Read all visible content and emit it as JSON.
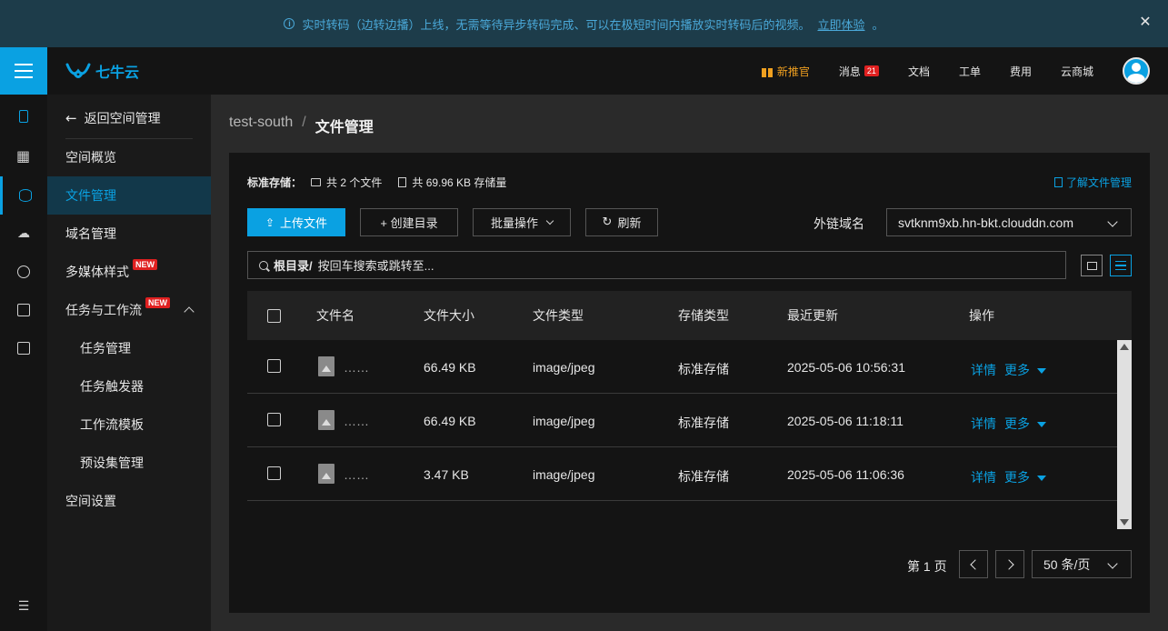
{
  "banner": {
    "text": "实时转码（边转边播）上线，无需等待异步转码完成、可以在极短时间内播放实时转码后的视频。",
    "link": "立即体验",
    "suffix": "。"
  },
  "topbar": {
    "logo": "七牛云",
    "nav": [
      {
        "label": "新推官"
      },
      {
        "label": "消息",
        "badge": "21"
      },
      {
        "label": "文档"
      },
      {
        "label": "工单"
      },
      {
        "label": "费用"
      },
      {
        "label": "云商城"
      }
    ]
  },
  "sidebar": {
    "back": "返回空间管理",
    "items": [
      {
        "label": "空间概览"
      },
      {
        "label": "文件管理"
      },
      {
        "label": "域名管理"
      },
      {
        "label": "多媒体样式",
        "tag": "NEW"
      },
      {
        "label": "任务与工作流",
        "tag": "NEW"
      },
      {
        "label": "任务管理"
      },
      {
        "label": "任务触发器"
      },
      {
        "label": "工作流模板"
      },
      {
        "label": "预设集管理"
      },
      {
        "label": "空间设置"
      }
    ]
  },
  "breadcrumb": {
    "bucket": "test-south",
    "sep": "/",
    "current": "文件管理"
  },
  "stats": {
    "label": "标准存储：",
    "files": "共 2 个文件",
    "size": "共 69.96 KB 存储量",
    "learn": "了解文件管理"
  },
  "toolbar": {
    "upload": "上传文件",
    "mkdir": "+ 创建目录",
    "batch": "批量操作",
    "refresh": "刷新",
    "domain_label": "外链域名",
    "domain_value": "svtknm9xb.hn-bkt.clouddn.com"
  },
  "search": {
    "prefix": "根目录/",
    "placeholder": "按回车搜索或跳转至..."
  },
  "table": {
    "headers": [
      "文件名",
      "文件大小",
      "文件类型",
      "存储类型",
      "最近更新",
      "操作"
    ],
    "rows": [
      {
        "name": "……",
        "size": "66.49 KB",
        "type": "image/jpeg",
        "storage": "标准存储",
        "updated": "2025-05-06 10:56:31",
        "detail": "详情",
        "more": "更多"
      },
      {
        "name": "……",
        "size": "66.49 KB",
        "type": "image/jpeg",
        "storage": "标准存储",
        "updated": "2025-05-06 11:18:11",
        "detail": "详情",
        "more": "更多"
      },
      {
        "name": "……",
        "size": "3.47 KB",
        "type": "image/jpeg",
        "storage": "标准存储",
        "updated": "2025-05-06 11:06:36",
        "detail": "详情",
        "more": "更多"
      }
    ]
  },
  "pager": {
    "label": "第 1 页",
    "size": "50 条/页"
  },
  "colors": {
    "accent": "#0aa1e2",
    "badge": "#e02020",
    "gift": "#f0a020"
  }
}
